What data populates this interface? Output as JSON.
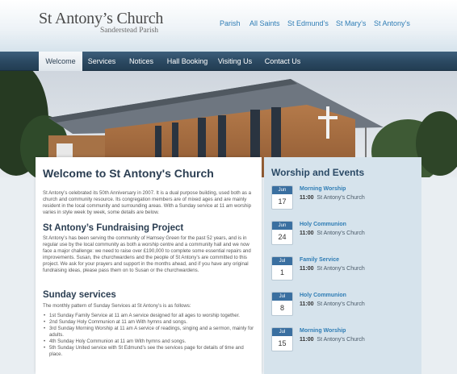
{
  "header": {
    "title": "St Antony’s Church",
    "subtitle": "Sanderstead Parish",
    "site_links": [
      "Parish",
      "All Saints",
      "St Edmund’s",
      "St Mary’s",
      "St Antony’s"
    ]
  },
  "nav": {
    "items": [
      "Welcome",
      "Services",
      "Notices",
      "Hall Booking",
      "Visiting Us",
      "Contact Us"
    ],
    "active": "Welcome"
  },
  "main": {
    "heading": "Welcome to St Antony's Church",
    "intro": "St Antony’s celebrated its 50th Anniversary in 2007.  It is a dual purpose building, used both as a church and community resource.  Its congregation members are of mixed ages and are mainly resident in the local community and surrounding areas.  With a Sunday service at 11 am worship varies in style week by week, some details are below.",
    "project_heading": "St Antony’s Fundraising Project",
    "project_text": "St Antony’s has been serving the community of Hamsey Green for the past 52 years, and is in regular use by the local community as both a worship centre and a community hall and we now face a major challenge: we need to raise over £190,000 to complete some essential repairs and improvements. Susan, the churchwardens and the people of St Antony’s are committed to this project. We ask for your prayers and support in the months ahead, and if you have any original fundraising ideas, please pass them on to Susan or the churchwardens.",
    "services_heading": "Sunday services",
    "services_intro": "The monthly pattern of Sunday Services at St Antony’s is as follows:",
    "services": [
      "1st Sunday Family Service at 11 am A service designed for all ages to worship together.",
      "2nd Sunday Holy Communion at 11 am With hymns and songs.",
      "3rd Sunday Morning Worship at 11 am A service of readings, singing and a sermon, mainly for adults.",
      "4th Sunday Holy Communion at 11 am With hymns and songs.",
      "5th Sunday United service with St Edmund’s see the services page for details of time and place."
    ]
  },
  "sidebar": {
    "heading": "Worship and Events",
    "events": [
      {
        "month": "Jun",
        "day": "17",
        "title": "Morning Worship",
        "time": "11:00",
        "place": "St Antony's Church"
      },
      {
        "month": "Jun",
        "day": "24",
        "title": "Holy Communion",
        "time": "11:00",
        "place": "St Antony's Church"
      },
      {
        "month": "Jul",
        "day": "1",
        "title": "Family Service",
        "time": "11:00",
        "place": "St Antony's Church"
      },
      {
        "month": "Jul",
        "day": "8",
        "title": "Holy Communion",
        "time": "11:00",
        "place": "St Antony's Church"
      },
      {
        "month": "Jul",
        "day": "15",
        "title": "Morning Worship",
        "time": "11:00",
        "place": "St Antony's Church"
      }
    ]
  }
}
